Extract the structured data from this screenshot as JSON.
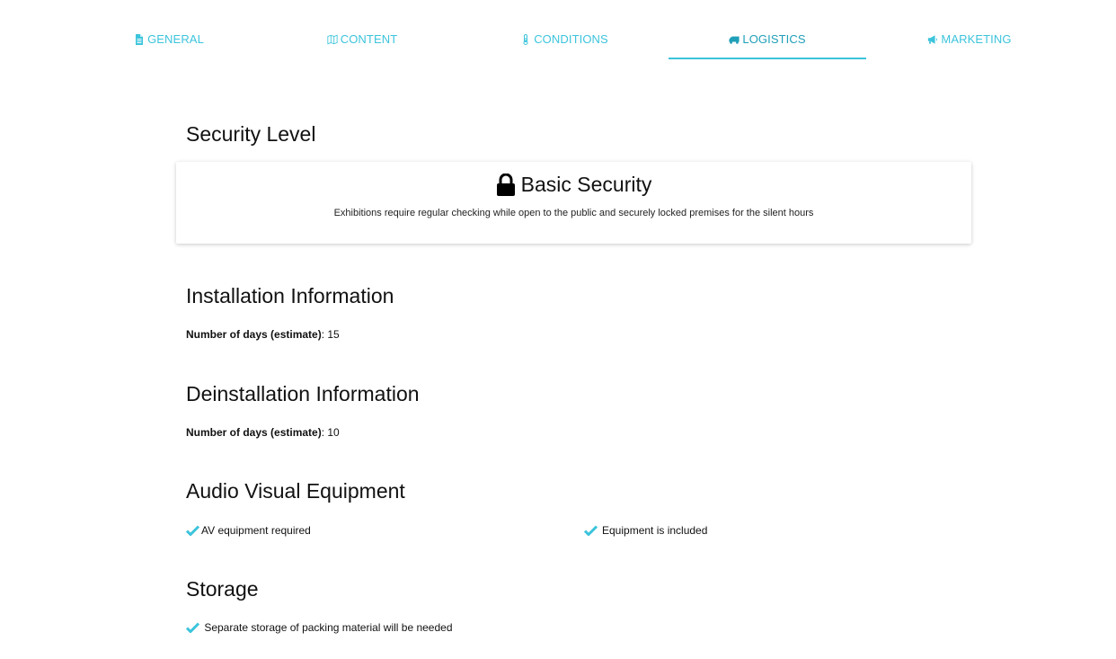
{
  "tabs": [
    {
      "label": "GENERAL",
      "icon": "file-icon",
      "active": false
    },
    {
      "label": "CONTENT",
      "icon": "map-icon",
      "active": false
    },
    {
      "label": "CONDITIONS",
      "icon": "thermometer-icon",
      "active": false
    },
    {
      "label": "LOGISTICS",
      "icon": "truck-icon",
      "active": true
    },
    {
      "label": "MARKETING",
      "icon": "megaphone-icon",
      "active": false
    }
  ],
  "accent_color": "#3cc4dc",
  "security": {
    "heading": "Security Level",
    "icon": "lock-icon",
    "level": "Basic Security",
    "description": "Exhibitions require regular checking while open to the public and securely locked premises for the silent hours"
  },
  "installation": {
    "heading": "Installation Information",
    "label": "Number of days (estimate)",
    "value": ": 15"
  },
  "deinstallation": {
    "heading": "Deinstallation Information",
    "label": "Number of days (estimate)",
    "value": ": 10"
  },
  "av": {
    "heading": "Audio Visual Equipment",
    "items": [
      "AV equipment required",
      "Equipment is included"
    ]
  },
  "storage": {
    "heading": "Storage",
    "items": [
      " Separate storage of packing material will be needed"
    ]
  }
}
